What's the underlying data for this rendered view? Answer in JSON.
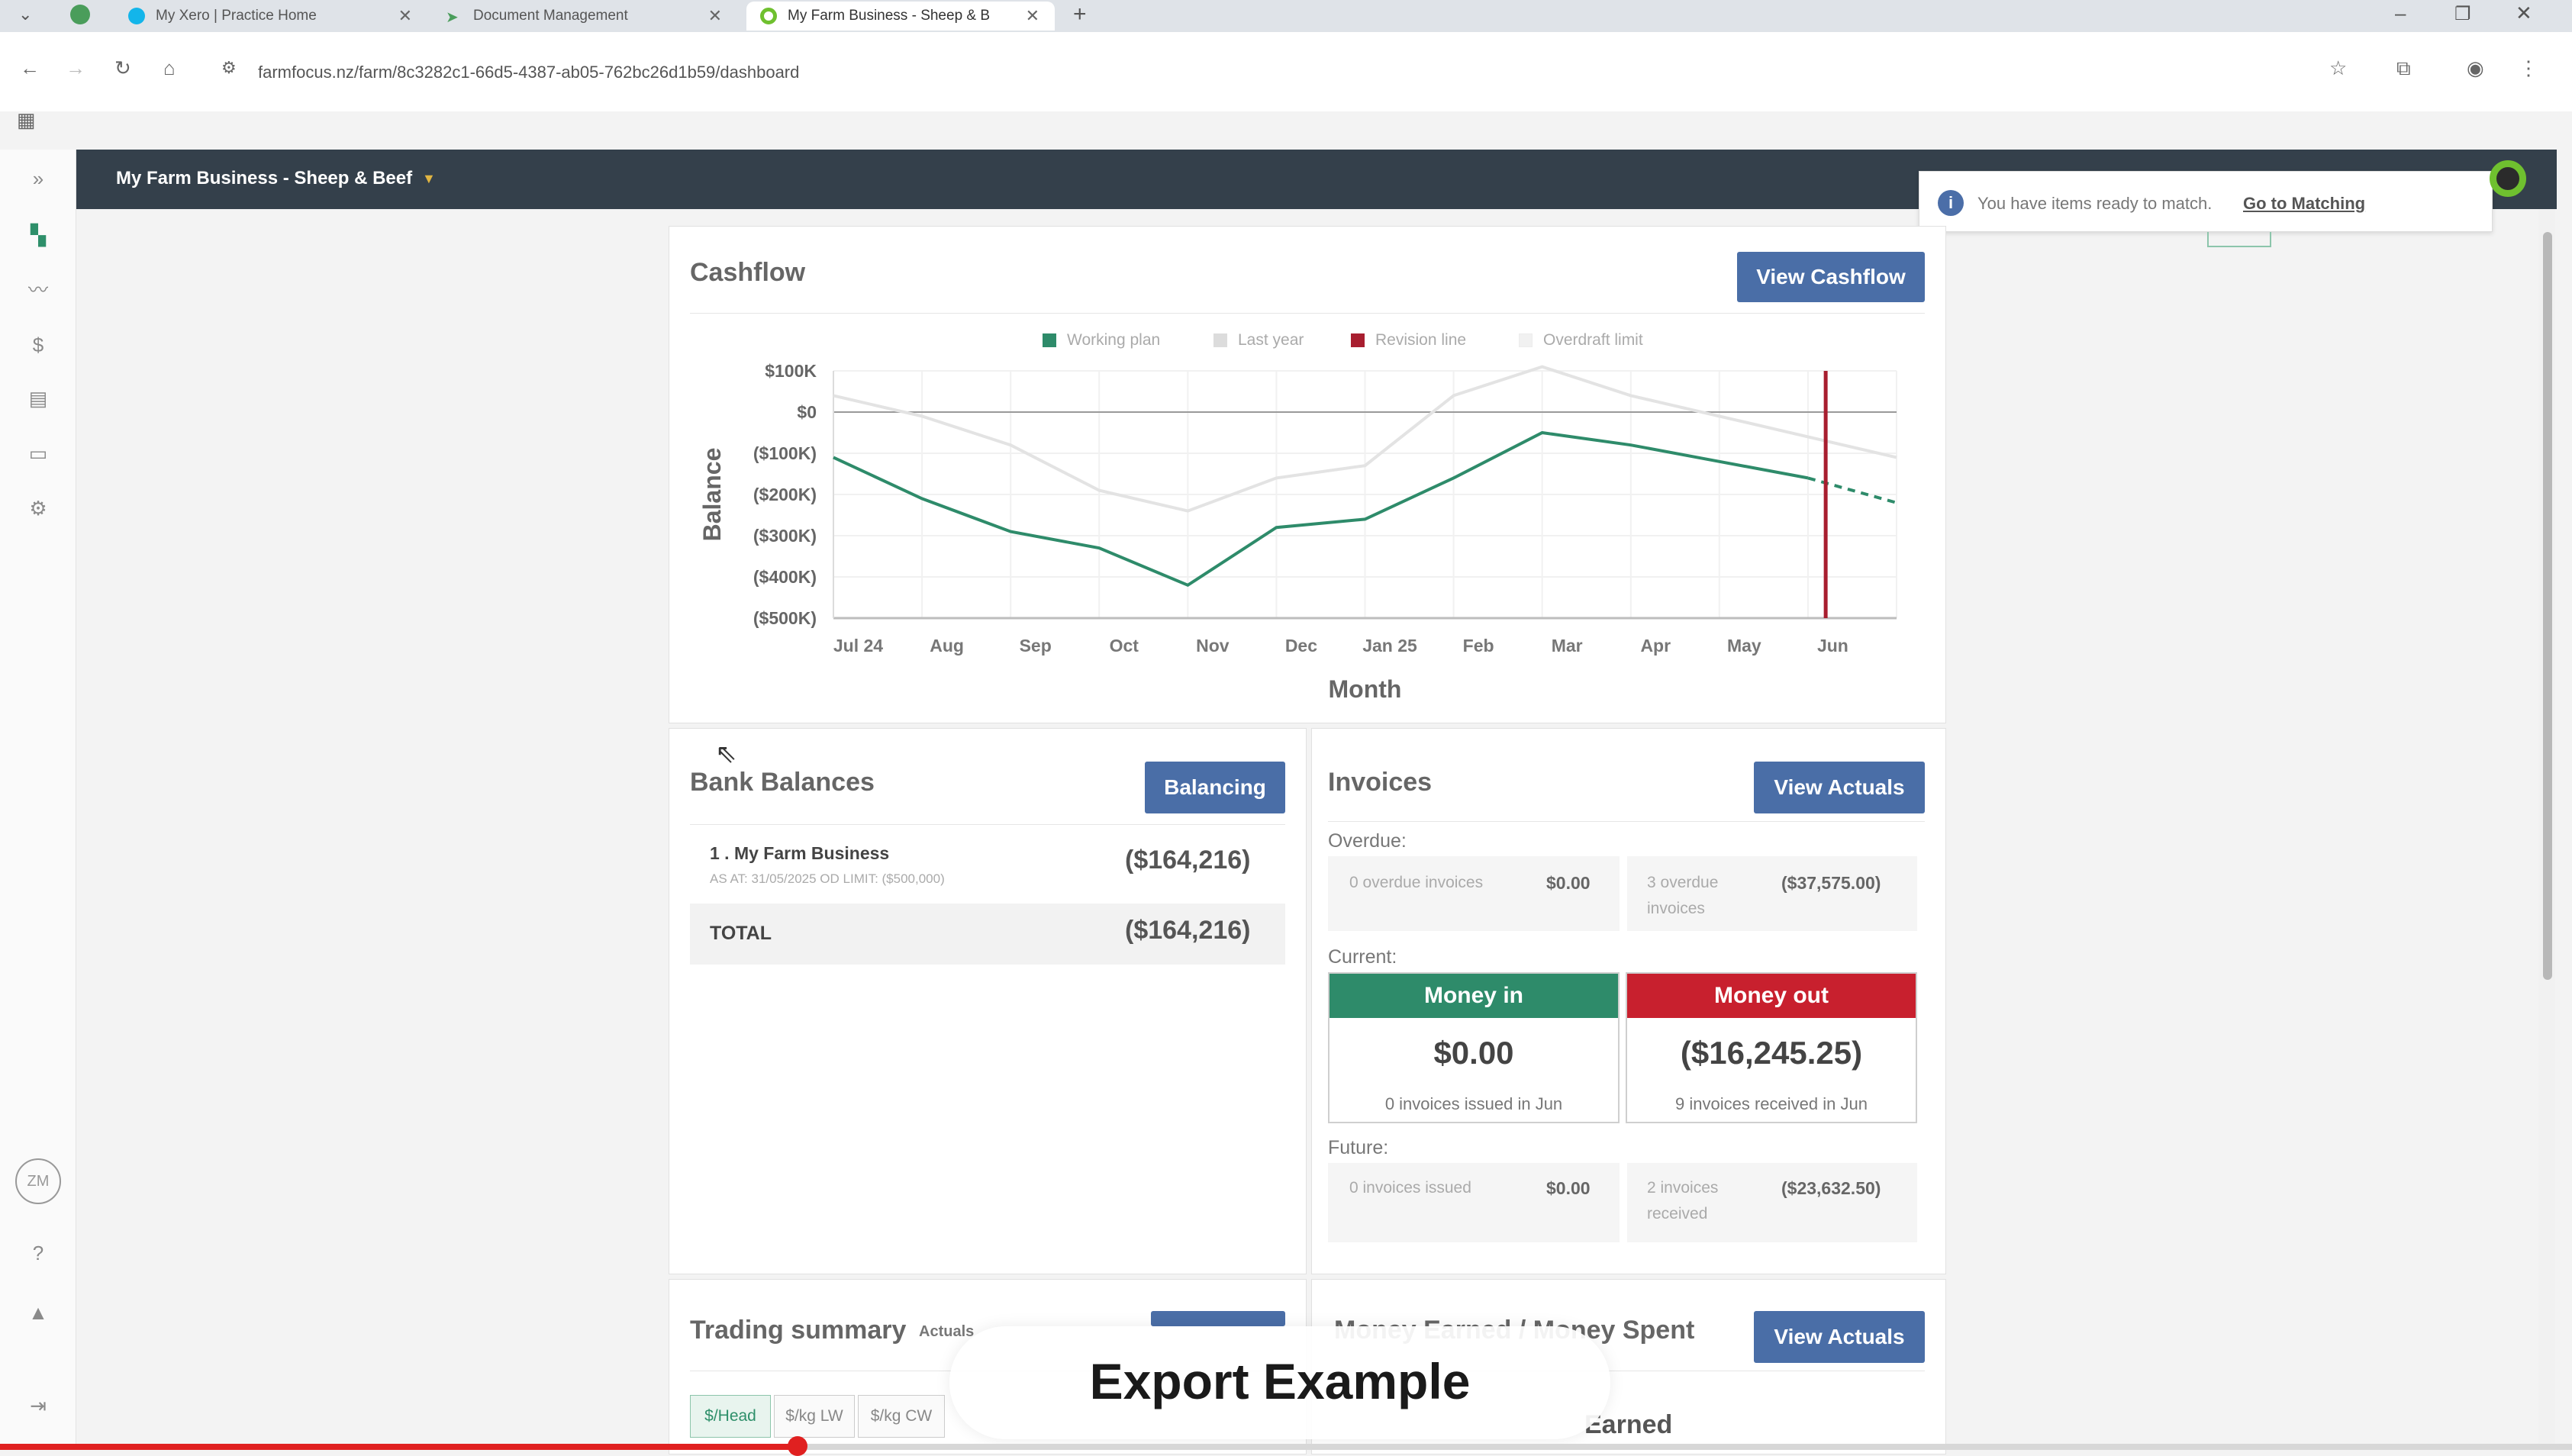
{
  "browser": {
    "tabs": [
      {
        "title": "My Xero | Practice Home",
        "favicon_color": "#13b5ea"
      },
      {
        "title": "Document Management",
        "favicon_color": "#4a9d5b"
      },
      {
        "title": "My Farm Business - Sheep & B",
        "favicon_color": "#6fc02f"
      }
    ],
    "url": "farmfocus.nz/farm/8c3282c1-66d5-4387-ab05-762bc26d1b59/dashboard"
  },
  "app": {
    "farm_name": "My Farm Business - Sheep & Beef",
    "toast": {
      "text": "You have items ready to match.",
      "link": "Go to Matching"
    },
    "avatar_initials": "ZM"
  },
  "cashflow": {
    "title": "Cashflow",
    "button": "View Cashflow"
  },
  "chart_data": {
    "type": "line",
    "ylabel": "Balance",
    "xlabel": "Month",
    "categories": [
      "Jul 24",
      "Aug",
      "Sep",
      "Oct",
      "Nov",
      "Dec",
      "Jan 25",
      "Feb",
      "Mar",
      "Apr",
      "May",
      "Jun"
    ],
    "y_ticks": [
      "$100K",
      "$0",
      "($100K)",
      "($200K)",
      "($300K)",
      "($400K)",
      "($500K)"
    ],
    "ylim": [
      -500,
      100
    ],
    "legend_position": "top",
    "series": [
      {
        "name": "Working plan",
        "color": "#2e8b6a",
        "values": [
          -110,
          -210,
          -290,
          -330,
          -420,
          -280,
          -260,
          -160,
          -50,
          -80,
          -120,
          -160,
          -220
        ]
      },
      {
        "name": "Last year",
        "color": "#e3e3e3",
        "values": [
          40,
          -10,
          -80,
          -190,
          -240,
          -160,
          -130,
          40,
          110,
          40,
          -10,
          -60,
          -110
        ]
      },
      {
        "name": "Revision line",
        "color": "#a81e2f",
        "values": []
      },
      {
        "name": "Overdraft limit",
        "color": "#f3f3f3",
        "values": []
      }
    ],
    "revision_month": "Jun"
  },
  "bank": {
    "title": "Bank Balances",
    "button": "Balancing",
    "account_name": "1 . My Farm Business",
    "account_sub": "AS AT: 31/05/2025   OD LIMIT: ($500,000)",
    "account_amount": "($164,216)",
    "total_label": "TOTAL",
    "total_amount": "($164,216)"
  },
  "invoices": {
    "title": "Invoices",
    "button": "View Actuals",
    "overdue_label": "Overdue:",
    "overdue_in_text": "0 overdue invoices",
    "overdue_in_value": "$0.00",
    "overdue_out_text": "3 overdue invoices",
    "overdue_out_value": "($37,575.00)",
    "current_label": "Current:",
    "money_in_title": "Money in",
    "money_in_amount": "$0.00",
    "money_in_sub": "0 invoices issued in Jun",
    "money_out_title": "Money out",
    "money_out_amount": "($16,245.25)",
    "money_out_sub": "9 invoices received in Jun",
    "future_label": "Future:",
    "future_in_text": "0 invoices issued",
    "future_in_value": "$0.00",
    "future_out_text": "2 invoices received",
    "future_out_value": "($23,632.50)",
    "colors": {
      "money_in": "#2e8b6a",
      "money_out": "#c8202e"
    }
  },
  "trading": {
    "title": "Trading summary",
    "subtitle": "Actuals",
    "tabs": [
      "$/Head",
      "$/kg LW",
      "$/kg CW"
    ]
  },
  "money_earned": {
    "title": "Money Earned / Money Spent",
    "button": "View Actuals",
    "sub": "Earned"
  },
  "video": {
    "caption": "Export Example",
    "progress": 0.31
  }
}
